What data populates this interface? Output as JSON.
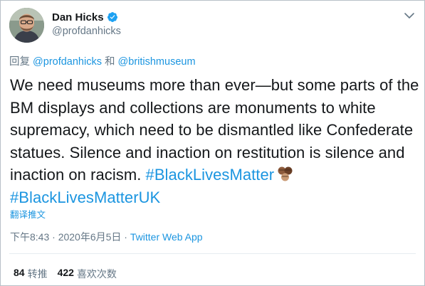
{
  "user": {
    "display_name": "Dan Hicks",
    "handle": "@profdanhicks",
    "verified": true
  },
  "reply": {
    "prefix": "回复 ",
    "mention1": "@profdanhicks",
    "conj": " 和 ",
    "mention2": "@britishmuseum"
  },
  "tweet": {
    "text": "We need museums more than ever—but some parts of the BM displays and collections are monuments to white supremacy, which need to be dismantled like Confederate statues. Silence and inaction on restitution is silence and inaction on racism. ",
    "hashtag1": "#BlackLivesMatter",
    "hashtag2": "#BlackLivesMatterUK"
  },
  "translate_label": "翻译推文",
  "meta": {
    "time": "下午8:43",
    "sep1": " · ",
    "date": "2020年6月5日",
    "sep2": " · ",
    "source": "Twitter Web App"
  },
  "stats": {
    "retweets_count": "84",
    "retweets_label": "转推",
    "likes_count": "422",
    "likes_label": "喜欢次数"
  },
  "colors": {
    "link": "#1b95e0",
    "secondary": "#657786",
    "text": "#14171a",
    "verified": "#1da1f2"
  },
  "icons": {
    "verified": "verified-badge-icon",
    "menu": "chevron-down-icon",
    "emoji": "raised-fist-emoji"
  }
}
